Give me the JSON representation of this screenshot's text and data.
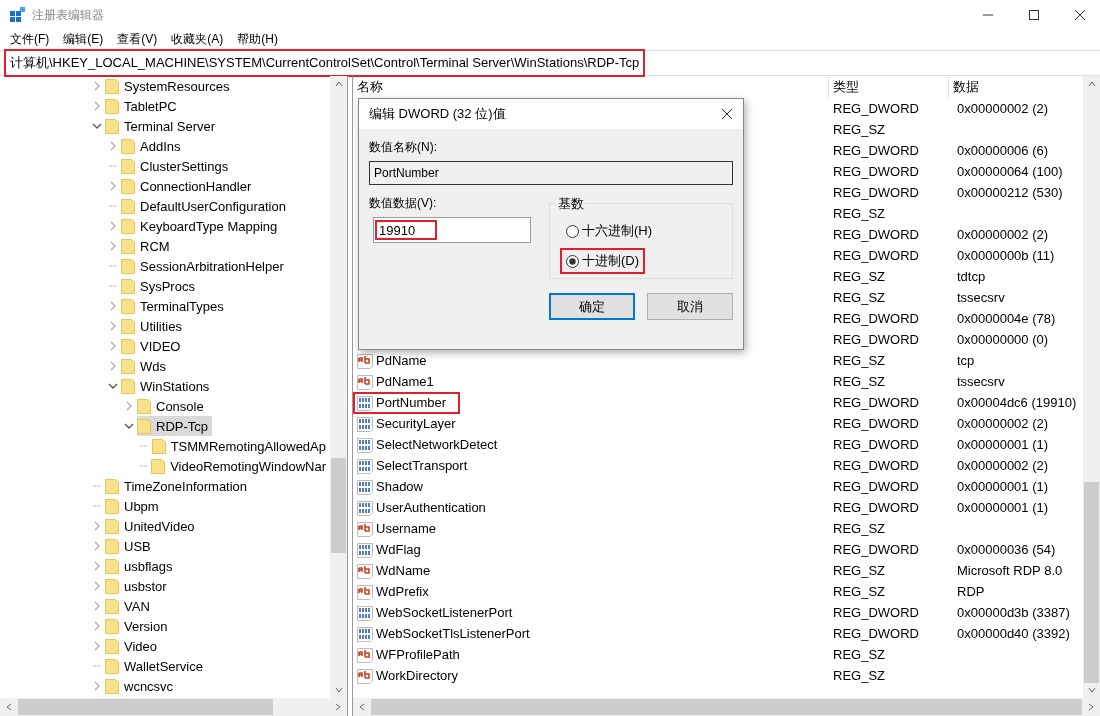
{
  "window": {
    "title": "注册表编辑器"
  },
  "menu": [
    "文件(F)",
    "编辑(E)",
    "查看(V)",
    "收藏夹(A)",
    "帮助(H)"
  ],
  "address": {
    "path": "计算机\\HKEY_LOCAL_MACHINE\\SYSTEM\\CurrentControlSet\\Control\\Terminal Server\\WinStations\\RDP-Tcp",
    "highlighted": true
  },
  "tree": [
    {
      "label": "SystemResources",
      "kind": "node",
      "expanded": false,
      "selected": false
    },
    {
      "label": "TabletPC",
      "kind": "node",
      "expanded": false,
      "selected": false
    },
    {
      "label": "Terminal Server",
      "kind": "node",
      "expanded": true,
      "selected": false,
      "children": [
        {
          "label": "AddIns",
          "kind": "node",
          "expanded": false,
          "selected": false
        },
        {
          "label": "ClusterSettings",
          "kind": "leaf",
          "selected": false
        },
        {
          "label": "ConnectionHandler",
          "kind": "node",
          "expanded": false,
          "selected": false
        },
        {
          "label": "DefaultUserConfiguration",
          "kind": "leaf",
          "selected": false
        },
        {
          "label": "KeyboardType Mapping",
          "kind": "node",
          "expanded": false,
          "selected": false
        },
        {
          "label": "RCM",
          "kind": "node",
          "expanded": false,
          "selected": false
        },
        {
          "label": "SessionArbitrationHelper",
          "kind": "leaf",
          "selected": false
        },
        {
          "label": "SysProcs",
          "kind": "leaf",
          "selected": false
        },
        {
          "label": "TerminalTypes",
          "kind": "node",
          "expanded": false,
          "selected": false
        },
        {
          "label": "Utilities",
          "kind": "node",
          "expanded": false,
          "selected": false
        },
        {
          "label": "VIDEO",
          "kind": "node",
          "expanded": false,
          "selected": false
        },
        {
          "label": "Wds",
          "kind": "node",
          "expanded": false,
          "selected": false
        },
        {
          "label": "WinStations",
          "kind": "node",
          "expanded": true,
          "selected": false,
          "children": [
            {
              "label": "Console",
              "kind": "node",
              "expanded": false,
              "selected": false
            },
            {
              "label": "RDP-Tcp",
              "kind": "node",
              "expanded": true,
              "selected": true,
              "children": [
                {
                  "label": "TSMMRemotingAllowedAp",
                  "kind": "leaf",
                  "selected": false
                },
                {
                  "label": "VideoRemotingWindowNar",
                  "kind": "leaf",
                  "selected": false
                }
              ]
            }
          ]
        }
      ]
    },
    {
      "label": "TimeZoneInformation",
      "kind": "leaf",
      "selected": false
    },
    {
      "label": "Ubpm",
      "kind": "leaf",
      "selected": false
    },
    {
      "label": "UnitedVideo",
      "kind": "node",
      "expanded": false,
      "selected": false
    },
    {
      "label": "USB",
      "kind": "node",
      "expanded": false,
      "selected": false
    },
    {
      "label": "usbflags",
      "kind": "node",
      "expanded": false,
      "selected": false
    },
    {
      "label": "usbstor",
      "kind": "node",
      "expanded": false,
      "selected": false
    },
    {
      "label": "VAN",
      "kind": "node",
      "expanded": false,
      "selected": false
    },
    {
      "label": "Version",
      "kind": "node",
      "expanded": false,
      "selected": false
    },
    {
      "label": "Video",
      "kind": "node",
      "expanded": false,
      "selected": false
    },
    {
      "label": "WalletService",
      "kind": "leaf",
      "selected": false
    },
    {
      "label": "wcncsvc",
      "kind": "node",
      "expanded": false,
      "selected": false
    }
  ],
  "values": {
    "columns": [
      "名称",
      "类型",
      "数据"
    ],
    "rows": [
      {
        "type": "REG_DWORD",
        "data": "0x00000002 (2)"
      },
      {
        "type": "REG_SZ"
      },
      {
        "type": "REG_DWORD",
        "data": "0x00000006 (6)"
      },
      {
        "type": "REG_DWORD",
        "data": "0x00000064 (100)"
      },
      {
        "type": "REG_DWORD",
        "data": "0x00000212 (530)"
      },
      {
        "type": "REG_SZ"
      },
      {
        "type": "REG_DWORD",
        "data": "0x00000002 (2)"
      },
      {
        "type": "REG_DWORD",
        "data": "0x0000000b (11)"
      },
      {
        "type": "REG_SZ",
        "data": "tdtcp"
      },
      {
        "type": "REG_SZ",
        "data": "tssecsrv"
      },
      {
        "type": "REG_DWORD",
        "data": "0x0000004e (78)"
      },
      {
        "type": "REG_DWORD",
        "data": "0x00000000 (0)"
      },
      {
        "name": "PdName",
        "kind": "string",
        "highlighted": false,
        "type": "REG_SZ",
        "data": "tcp"
      },
      {
        "name": "PdName1",
        "kind": "string",
        "highlighted": false,
        "type": "REG_SZ",
        "data": "tssecsrv"
      },
      {
        "name": "PortNumber",
        "kind": "dword",
        "highlighted": true,
        "type": "REG_DWORD",
        "data": "0x00004dc6 (19910)"
      },
      {
        "name": "SecurityLayer",
        "kind": "dword",
        "highlighted": false,
        "type": "REG_DWORD",
        "data": "0x00000002 (2)"
      },
      {
        "name": "SelectNetworkDetect",
        "kind": "dword",
        "highlighted": false,
        "type": "REG_DWORD",
        "data": "0x00000001 (1)"
      },
      {
        "name": "SelectTransport",
        "kind": "dword",
        "highlighted": false,
        "type": "REG_DWORD",
        "data": "0x00000002 (2)"
      },
      {
        "name": "Shadow",
        "kind": "dword",
        "highlighted": false,
        "type": "REG_DWORD",
        "data": "0x00000001 (1)"
      },
      {
        "name": "UserAuthentication",
        "kind": "dword",
        "highlighted": false,
        "type": "REG_DWORD",
        "data": "0x00000001 (1)"
      },
      {
        "name": "Username",
        "kind": "string",
        "highlighted": false,
        "type": "REG_SZ"
      },
      {
        "name": "WdFlag",
        "kind": "dword",
        "highlighted": false,
        "type": "REG_DWORD",
        "data": "0x00000036 (54)"
      },
      {
        "name": "WdName",
        "kind": "string",
        "highlighted": false,
        "type": "REG_SZ",
        "data": "Microsoft RDP 8.0"
      },
      {
        "name": "WdPrefix",
        "kind": "string",
        "highlighted": false,
        "type": "REG_SZ",
        "data": "RDP"
      },
      {
        "name": "WebSocketListenerPort",
        "kind": "dword",
        "highlighted": false,
        "type": "REG_DWORD",
        "data": "0x00000d3b (3387)"
      },
      {
        "name": "WebSocketTlsListenerPort",
        "kind": "dword",
        "highlighted": false,
        "type": "REG_DWORD",
        "data": "0x00000d40 (3392)"
      },
      {
        "name": "WFProfilePath",
        "kind": "string",
        "highlighted": false,
        "type": "REG_SZ"
      },
      {
        "name": "WorkDirectory",
        "kind": "string",
        "highlighted": false,
        "type": "REG_SZ"
      }
    ]
  },
  "dialog": {
    "title": "编辑 DWORD (32 位)值",
    "name_label": "数值名称(N):",
    "name_value": "PortNumber",
    "data_label": "数值数据(V):",
    "data_value": "19910",
    "data_highlighted": true,
    "base_label": "基数",
    "options": [
      {
        "label": "十六进制(H)",
        "selected": false,
        "highlighted": false
      },
      {
        "label": "十进制(D)",
        "selected": true,
        "highlighted": true
      }
    ],
    "buttons": [
      {
        "label": "确定",
        "default": true
      },
      {
        "label": "取消",
        "default": false
      }
    ]
  }
}
